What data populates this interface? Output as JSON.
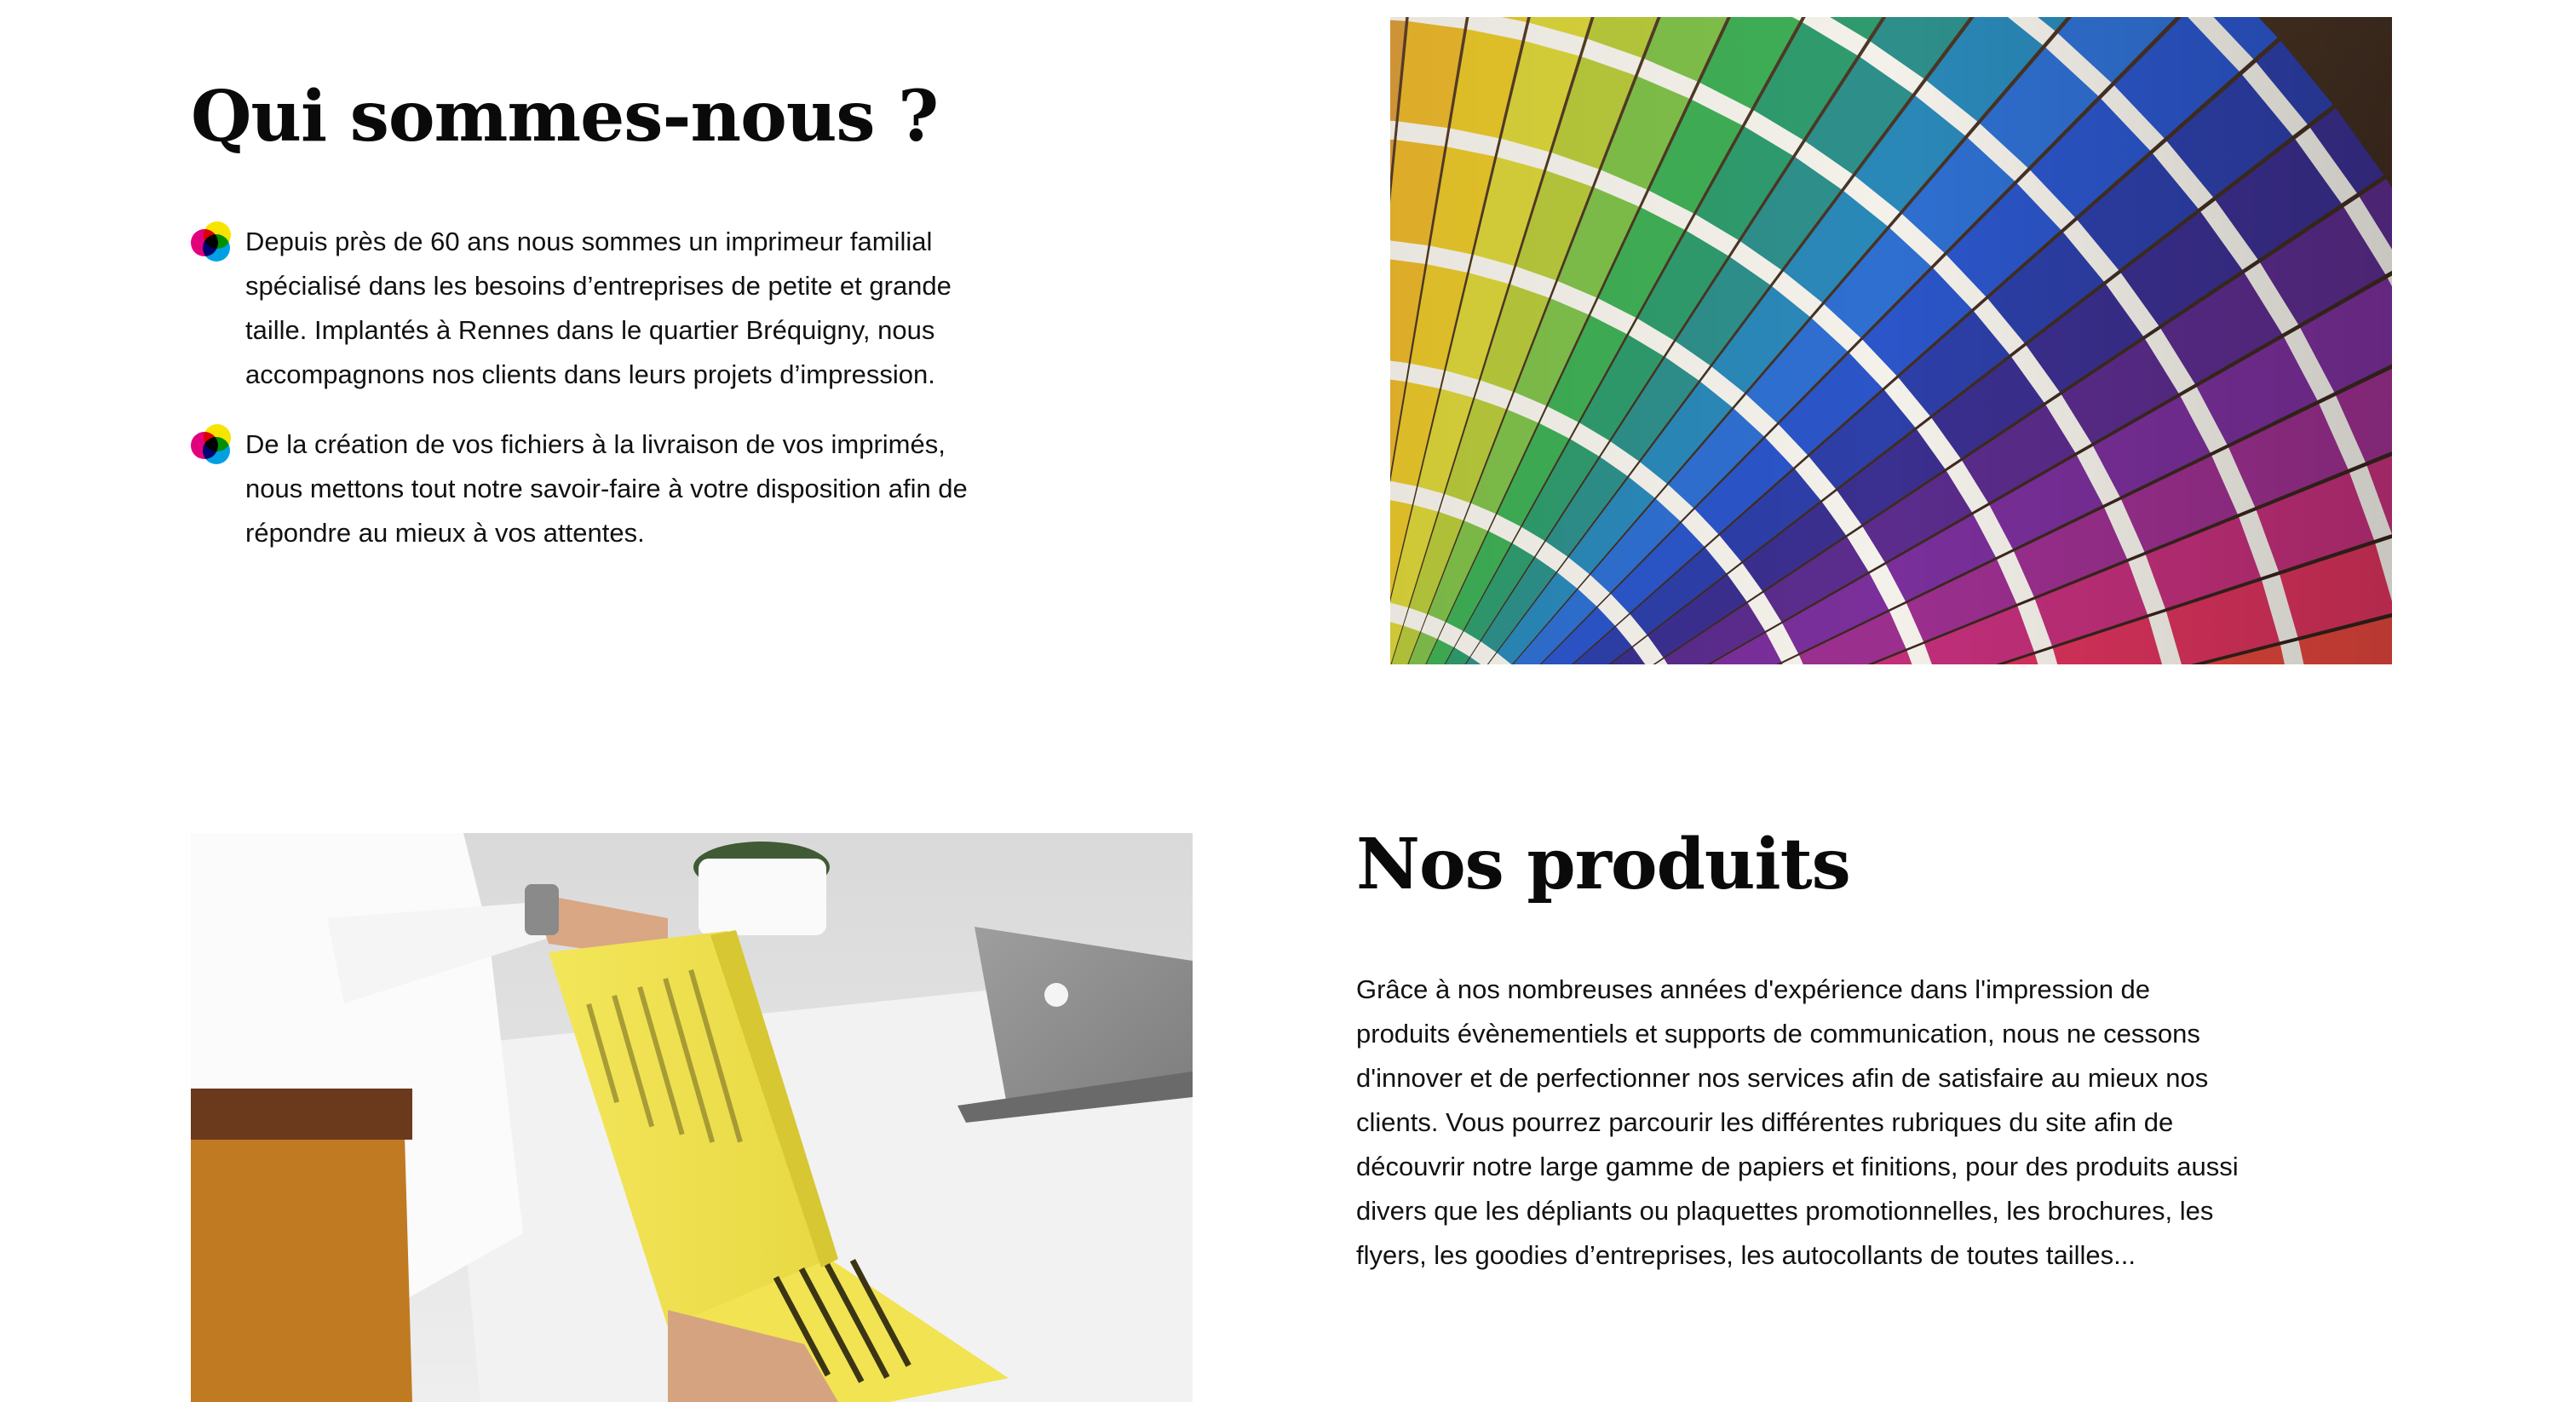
{
  "about": {
    "title": "Qui sommes-nous ?",
    "bullets": [
      "Depuis près de 60 ans nous sommes un imprimeur familial spécialisé dans les besoins d’entreprises de petite et grande taille. Implantés à Rennes dans le quartier Bréquigny, nous accompagnons nos clients dans leurs projets d’impression.",
      "De la création de vos fichiers à la livraison de vos imprimés, nous mettons tout notre savoir-faire à votre disposition afin de répondre au mieux à vos attentes."
    ],
    "bullet_icon": "cmyk-dots-icon"
  },
  "products": {
    "title": "Nos produits",
    "text": "Grâce à nos nombreuses années d'expérience dans l'impression de produits évènementiels et supports de communication, nous ne cessons d'innover et de perfectionner nos services afin de satisfaire au mieux nos clients. Vous pourrez parcourir les différentes rubriques du site afin de découvrir notre large gamme de papiers et finitions, pour des produits aussi divers que les dépliants ou plaquettes promotionnelles, les brochures, les flyers, les goodies d’entreprises, les autocollants de toutes tailles..."
  },
  "images": {
    "swatch": {
      "name": "color-swatch-fan-image"
    },
    "magazine": {
      "name": "person-reading-yellow-magazine-image"
    }
  },
  "colors": {
    "text": "#111111",
    "heading": "#0a0a0a",
    "cmyk_yellow": "#f7e400",
    "cmyk_magenta": "#e3007d",
    "cmyk_cyan": "#00a0e3",
    "magazine_yellow": "#efe24f"
  }
}
